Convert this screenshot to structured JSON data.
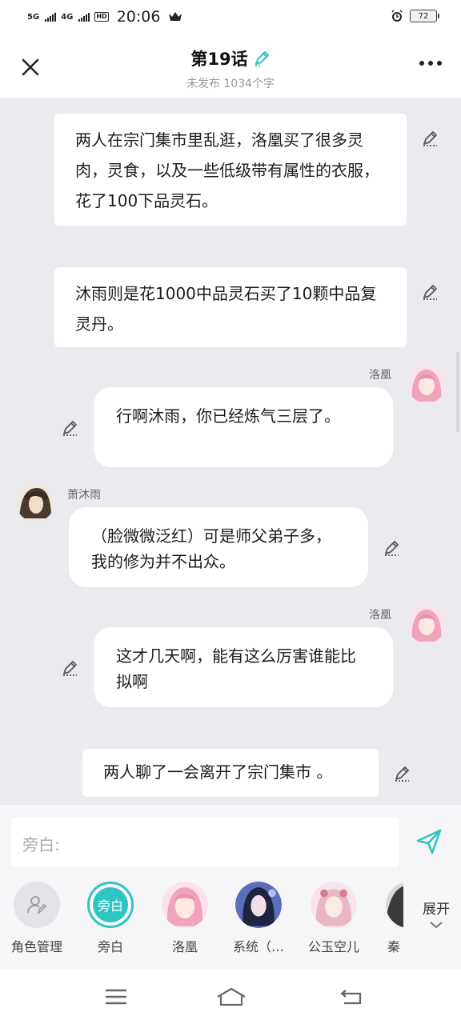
{
  "status": {
    "net1": "5G",
    "net2": "4G",
    "hd": "HD",
    "time": "20:06",
    "battery": "72"
  },
  "header": {
    "title": "第19话",
    "subtitle": "未发布 1034个字"
  },
  "messages": [
    {
      "type": "narration",
      "text": "两人在宗门集市里乱逛，洛凰买了很多灵肉，灵食，以及一些低级带有属性的衣服，花了100下品灵石。"
    },
    {
      "type": "narration",
      "text": "沐雨则是花1000中品灵石买了10颗中品复灵丹。"
    },
    {
      "type": "right",
      "name": "洛凰",
      "text": "行啊沐雨，你已经炼气三层了。"
    },
    {
      "type": "left",
      "name": "萧沐雨",
      "text": "（脸微微泛红）可是师父弟子多，我的修为并不出众。"
    },
    {
      "type": "right",
      "name": "洛凰",
      "text": "这才几天啊，能有这么厉害谁能比拟啊"
    },
    {
      "type": "narration",
      "text": "两人聊了一会离开了宗门集市 。"
    }
  ],
  "input": {
    "placeholder": "旁白:"
  },
  "roles": [
    {
      "label": "角色管理",
      "icon": "role-manage-icon"
    },
    {
      "label": "旁白",
      "icon": "narration-badge"
    },
    {
      "label": "洛凰",
      "icon": "avatar-luohuang"
    },
    {
      "label": "系统（…",
      "icon": "avatar-system"
    },
    {
      "label": "公玉空儿",
      "icon": "avatar-gongyu"
    },
    {
      "label": "秦",
      "icon": "avatar-partial"
    }
  ],
  "expand_label": "展开",
  "narration_badge_text": "旁白",
  "colors": {
    "accent": "#2ec4c4",
    "background": "#ebebef"
  }
}
